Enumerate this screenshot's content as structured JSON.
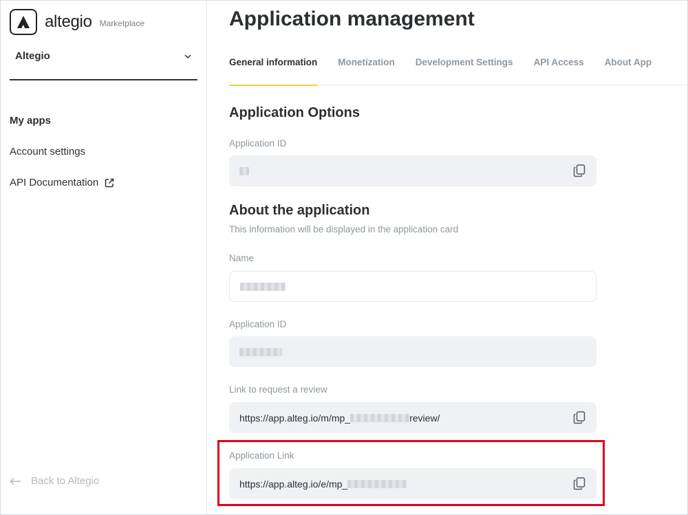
{
  "brand": {
    "name": "altegio",
    "sub": "Marketplace",
    "logo_icon": "altegio-logo-icon"
  },
  "company_selector": {
    "value": "Altegio",
    "icon": "chevron-down-icon"
  },
  "sidebar": {
    "items": [
      {
        "label": "My apps",
        "active": true
      },
      {
        "label": "Account settings",
        "active": false
      },
      {
        "label": "API Documentation",
        "active": false,
        "icon": "external-link-icon"
      }
    ],
    "back_label": "Back to Altegio"
  },
  "page": {
    "title": "Application management"
  },
  "tabs": [
    {
      "label": "General information",
      "active": true
    },
    {
      "label": "Monetization",
      "active": false
    },
    {
      "label": "Development Settings",
      "active": false
    },
    {
      "label": "API Access",
      "active": false
    },
    {
      "label": "About App",
      "active": false
    }
  ],
  "options_section": {
    "title": "Application Options",
    "app_id_label": "Application ID",
    "app_id_value": ""
  },
  "about_section": {
    "title": "About the application",
    "subtitle": "This information will be displayed in the application card",
    "name_label": "Name",
    "name_value": "",
    "app_id_label": "Application ID",
    "app_id_value": "",
    "review_label": "Link to request a review",
    "review_prefix": "https://app.alteg.io/m/mp_",
    "review_suffix": "review/",
    "app_link_label": "Application Link",
    "app_link_prefix": "https://app.alteg.io/e/mp_"
  },
  "colors": {
    "accent": "#f2d53c",
    "highlight": "#e0001a",
    "muted": "#8e98a0",
    "field_bg": "#eff1f4"
  }
}
